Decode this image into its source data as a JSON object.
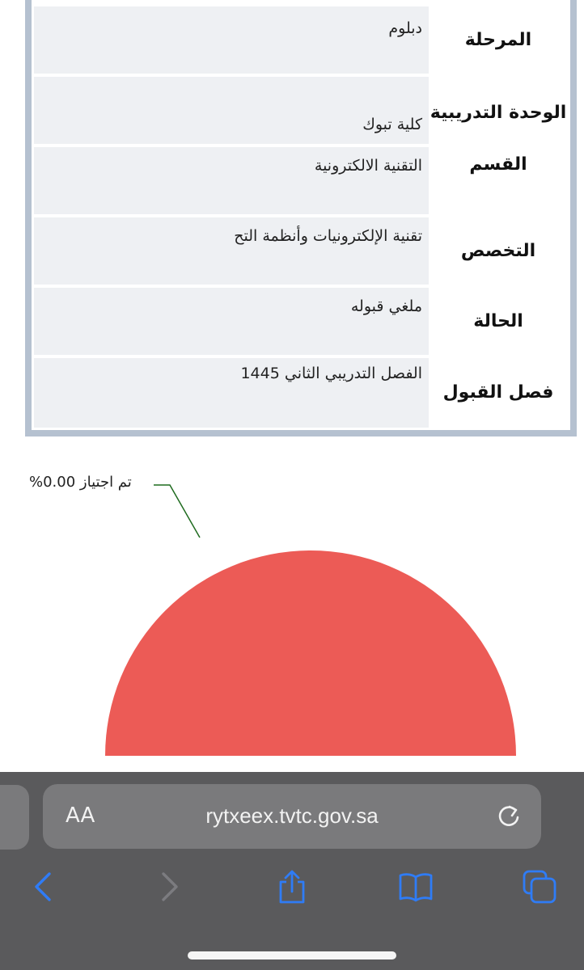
{
  "info_table": {
    "rows": [
      {
        "label": "المرحلة",
        "value": "دبلوم"
      },
      {
        "label": "الوحدة التدريبية",
        "value": "كلية تبوك"
      },
      {
        "label": "القسم",
        "value": "التقنية الالكترونية"
      },
      {
        "label": "التخصص",
        "value": "تقنية الإلكترونيات وأنظمة التح"
      },
      {
        "label": "الحالة",
        "value": "ملغي قبوله"
      },
      {
        "label": "فصل القبول",
        "value": "الفصل التدريبي الثاني 1445"
      }
    ]
  },
  "chart_data": {
    "type": "pie",
    "title": "",
    "slices": [
      {
        "label": "%تم اجتياز",
        "value": 0.0,
        "color": "#1f6b1f"
      },
      {
        "label": "",
        "value": 100,
        "color": "#ec5b56"
      }
    ],
    "callout_text": "%تم اجتياز  0.00"
  },
  "browser": {
    "text_size_button": "AA",
    "url": "rytxeex.tvtc.gov.sa",
    "icons": [
      "reload-icon",
      "back-icon",
      "forward-icon",
      "share-icon",
      "bookmarks-icon",
      "tabs-icon"
    ],
    "accent_color": "#2f7cf6"
  }
}
